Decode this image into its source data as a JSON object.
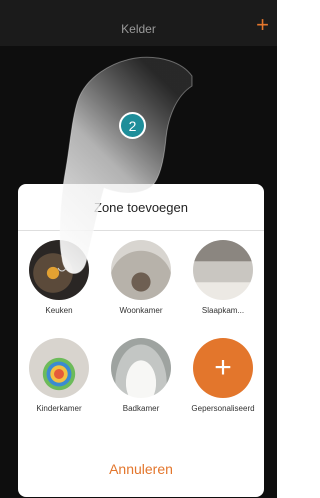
{
  "topbar": {
    "title": "Kelder",
    "add_icon": "plus-icon"
  },
  "sheet": {
    "title": "Zone toevoegen",
    "items": [
      {
        "label": "Keuken",
        "icon": "kitchen-photo"
      },
      {
        "label": "Woonkamer",
        "icon": "living-room-photo"
      },
      {
        "label": "Slaapkam...",
        "icon": "bedroom-photo"
      },
      {
        "label": "Kinderkamer",
        "icon": "kids-room-photo"
      },
      {
        "label": "Badkamer",
        "icon": "bathroom-photo"
      },
      {
        "label": "Gepersonaliseerd",
        "icon": "plus-icon",
        "symbol": "+"
      }
    ]
  },
  "cancel": {
    "label": "Annuleren"
  },
  "step": {
    "number": "2"
  },
  "colors": {
    "accent": "#e3762c",
    "badge": "#1e8e9a",
    "background": "#0e0e0e"
  }
}
